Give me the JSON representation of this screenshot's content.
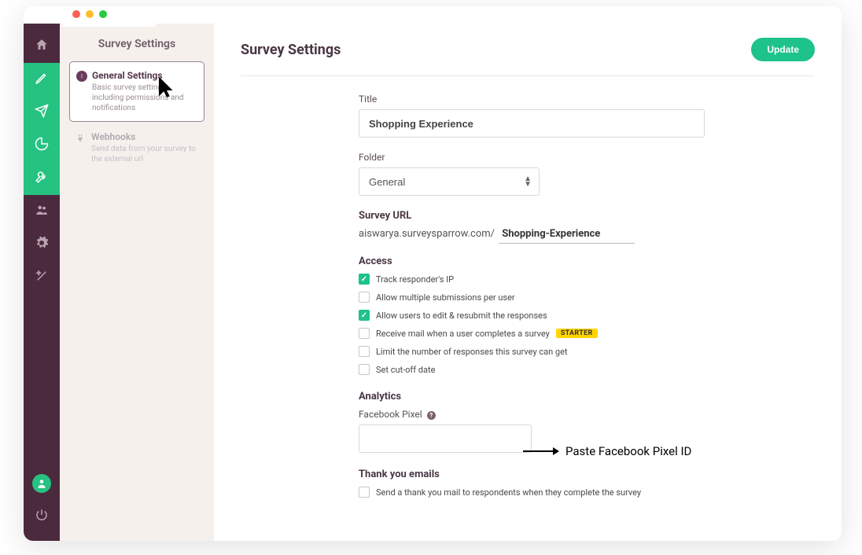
{
  "sidebar": {
    "title": "Survey Settings",
    "general": {
      "title": "General Settings",
      "desc": "Basic survey settings including permissions and notifications"
    },
    "webhooks": {
      "title": "Webhooks",
      "desc": "Send data from your survey to the external url"
    }
  },
  "main": {
    "title": "Survey Settings",
    "update_label": "Update",
    "title_label": "Title",
    "title_value": "Shopping Experience",
    "folder_label": "Folder",
    "folder_value": "General",
    "survey_url_label": "Survey URL",
    "survey_url_prefix": "aiswarya.surveysparrow.com/",
    "survey_url_slug": "Shopping-Experience",
    "access_label": "Access",
    "checkboxes": {
      "track_ip": "Track responder's IP",
      "multi_submit": "Allow multiple submissions per user",
      "edit_resubmit": "Allow users to edit & resubmit the responses",
      "receive_mail": "Receive mail when a user completes a survey",
      "limit_responses": "Limit the number of responses this survey can get",
      "cutoff": "Set cut-off date"
    },
    "starter_badge": "STARTER",
    "analytics_label": "Analytics",
    "fb_pixel_label": "Facebook Pixel",
    "thankyou_label": "Thank you emails",
    "thankyou_cb": "Send a thank you mail to respondents when they complete the survey"
  },
  "annotation": {
    "pixel_hint": "Paste Facebook Pixel ID"
  }
}
